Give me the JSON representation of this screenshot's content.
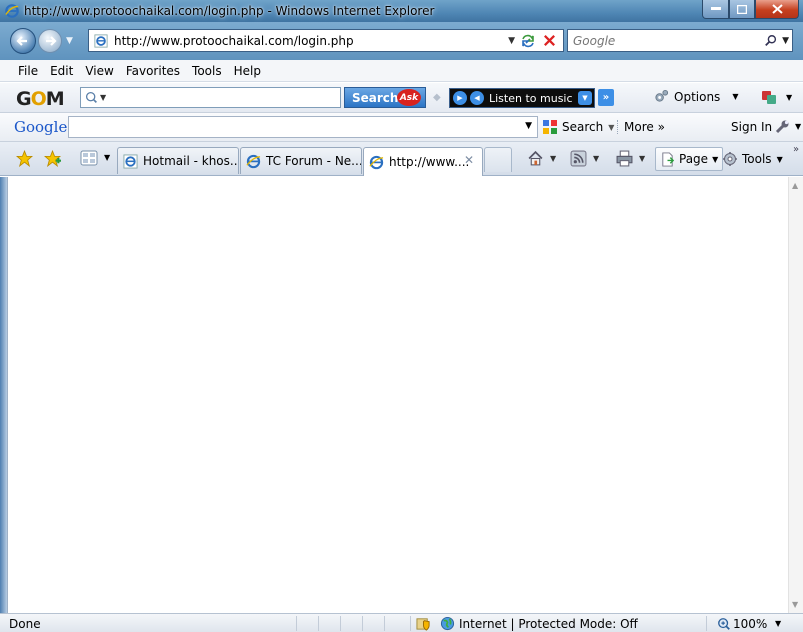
{
  "window": {
    "title": "http://www.protoochaikal.com/login.php - Windows Internet Explorer"
  },
  "address_bar": {
    "url": "http://www.protoochaikal.com/login.php",
    "search_placeholder": "Google"
  },
  "menu": {
    "items": [
      "File",
      "Edit",
      "View",
      "Favorites",
      "Tools",
      "Help"
    ]
  },
  "gom_toolbar": {
    "logo_prefix": "G",
    "logo_o": "O",
    "logo_suffix": "M",
    "search_button": "Search",
    "ask_badge": "Ask",
    "music_label": "Listen to music",
    "options_label": "Options"
  },
  "google_toolbar": {
    "logo": "Google",
    "search_label": "Search",
    "more_label": "More »",
    "sign_in": "Sign In"
  },
  "tabs": [
    {
      "label": "Hotmail - khos...",
      "active": false
    },
    {
      "label": "TC Forum - Ne...",
      "active": false
    },
    {
      "label": "http://www....",
      "active": true
    }
  ],
  "command_bar": {
    "page_label": "Page",
    "tools_label": "Tools"
  },
  "status_bar": {
    "status_text": "Done",
    "zone_text": "Internet | Protected Mode: Off",
    "zoom_text": "100%"
  },
  "colors": {
    "titlebar": "#4f86b4",
    "close_button": "#c6401f",
    "gom_search_button": "#2c74c5",
    "ask_red": "#d8231f"
  },
  "icons": [
    "ie-icon",
    "back-arrow-icon",
    "forward-arrow-icon",
    "refresh-icon",
    "stop-icon",
    "search-magnifier-icon",
    "gear-icon",
    "favorites-star-icon",
    "add-favorites-icon",
    "quick-tabs-icon",
    "home-icon",
    "feeds-icon",
    "print-icon",
    "page-icon",
    "tools-gear-icon",
    "shield-icon",
    "globe-icon",
    "zoom-icon",
    "wrench-icon"
  ]
}
